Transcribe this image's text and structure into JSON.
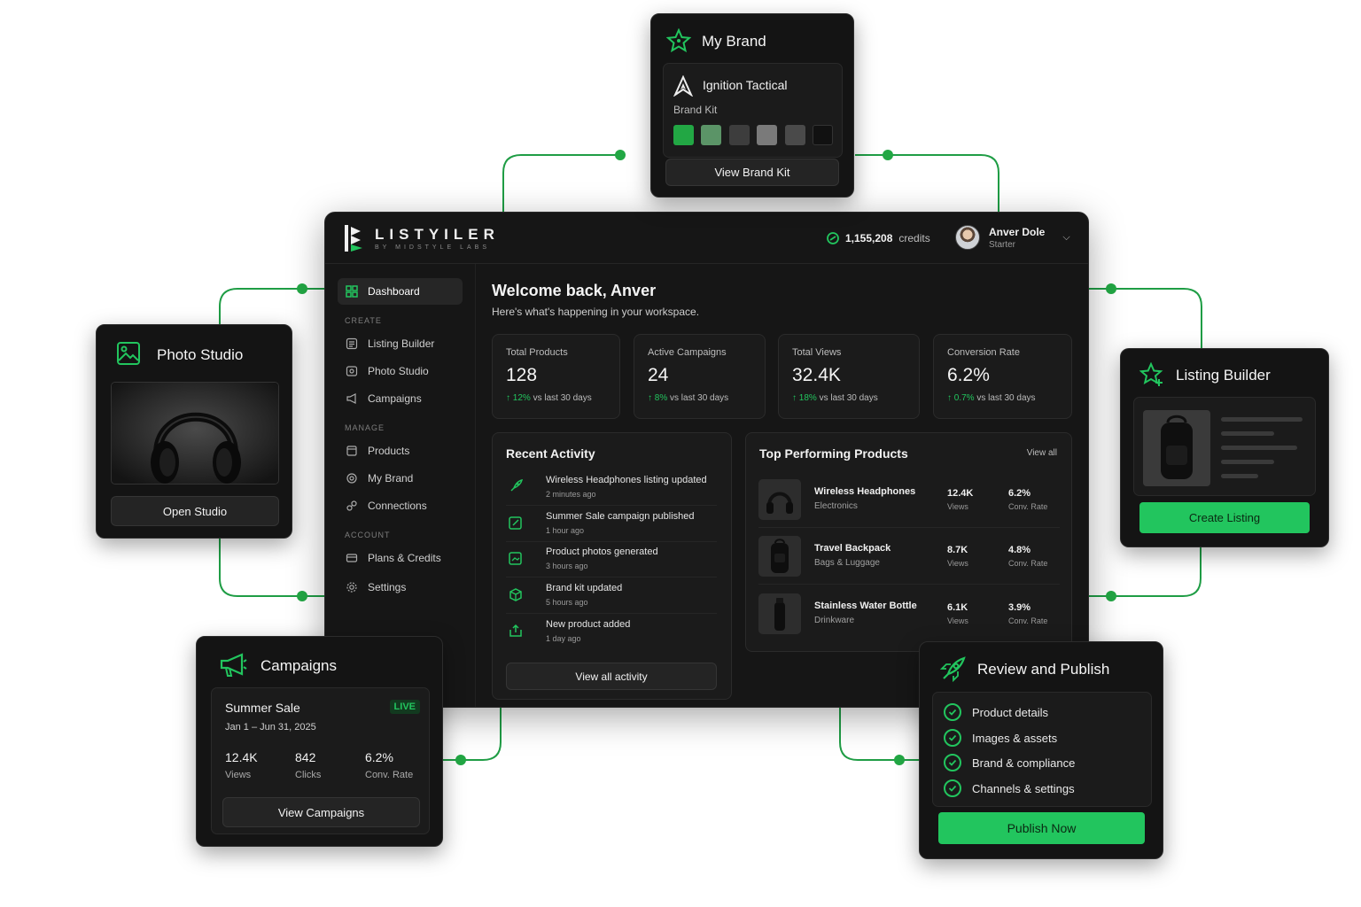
{
  "brand": {
    "name": "LISTYILER",
    "tagline": "BY MIDSTYLE LABS"
  },
  "header": {
    "credits_value": "1,155,208",
    "credits_unit": "credits",
    "user_name": "Anver Dole",
    "user_plan": "Starter"
  },
  "sidebar": {
    "dashboard": "Dashboard",
    "sections": {
      "create": "CREATE",
      "manage": "MANAGE",
      "account": "ACCOUNT"
    },
    "items": {
      "listing_builder": "Listing Builder",
      "photo_studio": "Photo Studio",
      "campaigns": "Campaigns",
      "products": "Products",
      "my_brand": "My Brand",
      "connections": "Connections",
      "plans": "Plans & Credits",
      "settings": "Settings"
    }
  },
  "main": {
    "welcome": "Welcome back, Anver",
    "subtitle": "Here's what's happening in your workspace.",
    "stats": [
      {
        "label": "Total Products",
        "value": "128",
        "delta": "12%",
        "delta_text": "vs last 30 days"
      },
      {
        "label": "Active Campaigns",
        "value": "24",
        "delta": "8%",
        "delta_text": "vs last 30 days"
      },
      {
        "label": "Total Views",
        "value": "32.4K",
        "delta": "18%",
        "delta_text": "vs last 30 days"
      },
      {
        "label": "Conversion Rate",
        "value": "6.2%",
        "delta": "0.7%",
        "delta_text": "vs last 30 days"
      }
    ],
    "activity": {
      "title": "Recent Activity",
      "items": [
        {
          "text": "Wireless Headphones listing updated",
          "time": "2 minutes ago"
        },
        {
          "text": "Summer Sale campaign published",
          "time": "1 hour ago"
        },
        {
          "text": "Product photos generated",
          "time": "3 hours ago"
        },
        {
          "text": "Brand kit updated",
          "time": "5 hours ago"
        },
        {
          "text": "New product added",
          "time": "1 day ago"
        }
      ],
      "button": "View all activity"
    },
    "top_products": {
      "title": "Top Performing Products",
      "view_all": "View all",
      "items": [
        {
          "name": "Wireless Headphones",
          "category": "Electronics",
          "views": "12.4K",
          "views_label": "Views",
          "rate": "6.2%",
          "rate_label": "Conv. Rate"
        },
        {
          "name": "Travel Backpack",
          "category": "Bags & Luggage",
          "views": "8.7K",
          "views_label": "Views",
          "rate": "4.8%",
          "rate_label": "Conv. Rate"
        },
        {
          "name": "Stainless Water Bottle",
          "category": "Drinkware",
          "views": "6.1K",
          "views_label": "Views",
          "rate": "3.9%",
          "rate_label": "Conv. Rate"
        }
      ]
    }
  },
  "cards": {
    "my_brand": {
      "title": "My Brand",
      "brand_name": "Ignition Tactical",
      "kit_label": "Brand Kit",
      "button": "View Brand Kit",
      "swatches": [
        "#22a744",
        "#5b9467",
        "#3d3d3d",
        "#7a7a7a",
        "#4a4a4a",
        "#111111"
      ]
    },
    "photo_studio": {
      "title": "Photo Studio",
      "button": "Open Studio"
    },
    "listing_builder": {
      "title": "Listing Builder",
      "button": "Create Listing"
    },
    "campaigns": {
      "title": "Campaigns",
      "campaign_name": "Summer Sale",
      "badge": "LIVE",
      "dates": "Jan 1 – Jun 31, 2025",
      "views": "12.4K",
      "views_label": "Views",
      "clicks": "842",
      "clicks_label": "Clicks",
      "rate": "6.2%",
      "rate_label": "Conv. Rate",
      "button": "View Campaigns"
    },
    "review": {
      "title": "Review and Publish",
      "checks": [
        "Product details",
        "Images & assets",
        "Brand & compliance",
        "Channels & settings"
      ],
      "button": "Publish Now"
    }
  },
  "colors": {
    "accent": "#22c55e",
    "panel": "#1b1b1b",
    "background": "#161616"
  }
}
